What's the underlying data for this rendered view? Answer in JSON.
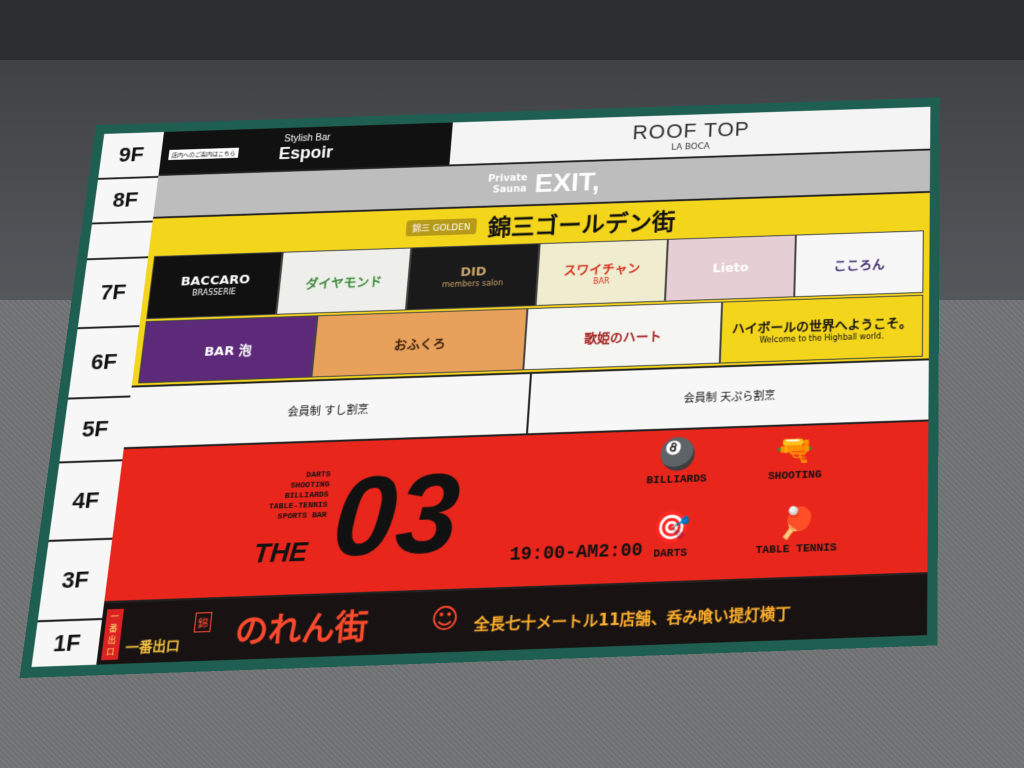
{
  "floors": [
    "9F",
    "8F",
    "",
    "7F",
    "6F",
    "5F",
    "4F",
    "3F",
    "1F"
  ],
  "row9": {
    "espoir_pre": "Stylish Bar",
    "espoir_name": "Espoir",
    "espoir_note": "店内へのご案内はこちら",
    "rooftop_name": "ROOF TOP",
    "rooftop_sub": "LA BOCA"
  },
  "row8": {
    "pre1": "Private",
    "pre2": "Sauna",
    "name": "EXIT,"
  },
  "golden": {
    "logo": "錦三 GOLDEN",
    "title": "錦三ゴールデン街",
    "shops7": [
      {
        "name": "BACCARO",
        "sub": "BRASSERIE",
        "bg": "#111111",
        "color": "#ffffff"
      },
      {
        "name": "ダイヤモンド",
        "sub": "",
        "bg": "#eeeeea",
        "color": "#3b8a3b"
      },
      {
        "name": "DID",
        "sub": "members salon",
        "bg": "#1a1a1a",
        "color": "#c9a36a"
      },
      {
        "name": "スワイチャン",
        "sub": "BAR",
        "bg": "#f0ecd0",
        "color": "#d5301f"
      },
      {
        "name": "Lieto",
        "sub": "",
        "bg": "#e6cfd4",
        "color": "#ffffff"
      },
      {
        "name": "こころん",
        "sub": "",
        "bg": "#f7f7f7",
        "color": "#3a2a6b"
      }
    ],
    "shops6": [
      {
        "name": "BAR 泡",
        "sub": "",
        "bg": "#5d2a7a",
        "color": "#ffffff"
      },
      {
        "name": "おふくろ",
        "sub": "",
        "bg": "#e8a15a",
        "color": "#3a1e0e"
      },
      {
        "name": "歌姫のハート",
        "sub": "",
        "bg": "#f5f5f2",
        "color": "#a32020"
      },
      {
        "name": "ハイボールの世界へようこそ。",
        "sub": "Welcome to the Highball world.",
        "bg": "#f3d51c",
        "color": "#111111"
      }
    ]
  },
  "row5": {
    "left": "会員制 すし割烹",
    "right": "会員制 天ぷら割烹"
  },
  "row03": {
    "list": [
      "DARTS",
      "SHOOTING",
      "BILLIARDS",
      "TABLE-TENNIS",
      "SPORTS BAR"
    ],
    "the": "THE",
    "big": "03",
    "hours": "19:00-AM2:00",
    "activities": [
      {
        "label": "BILLIARDS",
        "icon": "billiards-icon"
      },
      {
        "label": "SHOOTING",
        "icon": "revolver-icon"
      },
      {
        "label": "DARTS",
        "icon": "dart-icon"
      },
      {
        "label": "TABLE TENNIS",
        "icon": "ping-pong-icon"
      }
    ]
  },
  "row1": {
    "side": [
      "一",
      "番",
      "出",
      "口"
    ],
    "exit": "一番出口",
    "badge": "錦",
    "title": "のれん街",
    "tagline": "全長七十メートル11店舗、呑み喰い提灯横丁"
  }
}
